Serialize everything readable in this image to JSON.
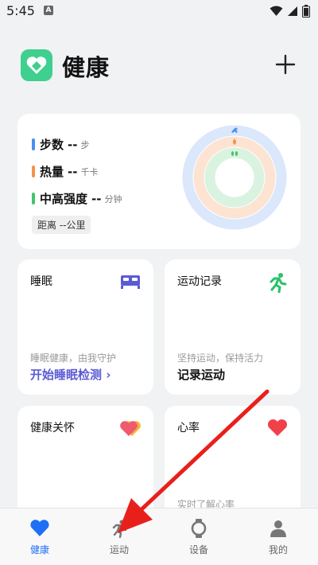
{
  "status_bar": {
    "time": "5:45",
    "notification_glyph": "A"
  },
  "header": {
    "title": "健康",
    "add_icon": "plus-icon"
  },
  "summary": {
    "metrics": [
      {
        "name": "步数",
        "value": "--",
        "unit": "步",
        "color": "#4a90f0"
      },
      {
        "name": "热量",
        "value": "--",
        "unit": "千卡",
        "color": "#f5924a"
      },
      {
        "name": "中高强度",
        "value": "--",
        "unit": "分钟",
        "color": "#46c46b"
      }
    ],
    "distance": "距离 --公里",
    "ring_colors": {
      "outer": "#dbe7fb",
      "middle": "#fde3d2",
      "inner": "#d9f3e0"
    }
  },
  "cards": {
    "sleep": {
      "title": "睡眠",
      "subtitle": "睡眠健康，由我守护",
      "action": "开始睡眠检测",
      "action_arrow": "›",
      "icon": "bed-icon",
      "accent": "#5b5bd6"
    },
    "exercise": {
      "title": "运动记录",
      "subtitle": "坚持运动，保持活力",
      "action": "记录运动",
      "icon": "running-icon",
      "accent": "#28c26a"
    },
    "care": {
      "title": "健康关怀",
      "icon": "care-hearts-icon"
    },
    "heart": {
      "title": "心率",
      "subtitle": "实时了解心率",
      "icon": "heart-icon",
      "accent": "#f0414b"
    }
  },
  "bottom_nav": {
    "items": [
      {
        "label": "健康",
        "icon": "heart-icon",
        "active": true
      },
      {
        "label": "运动",
        "icon": "running-icon",
        "active": false
      },
      {
        "label": "设备",
        "icon": "watch-icon",
        "active": false
      },
      {
        "label": "我的",
        "icon": "person-icon",
        "active": false
      }
    ],
    "active_color": "#1f6ff5"
  },
  "annotation": {
    "color": "#e8201c"
  }
}
